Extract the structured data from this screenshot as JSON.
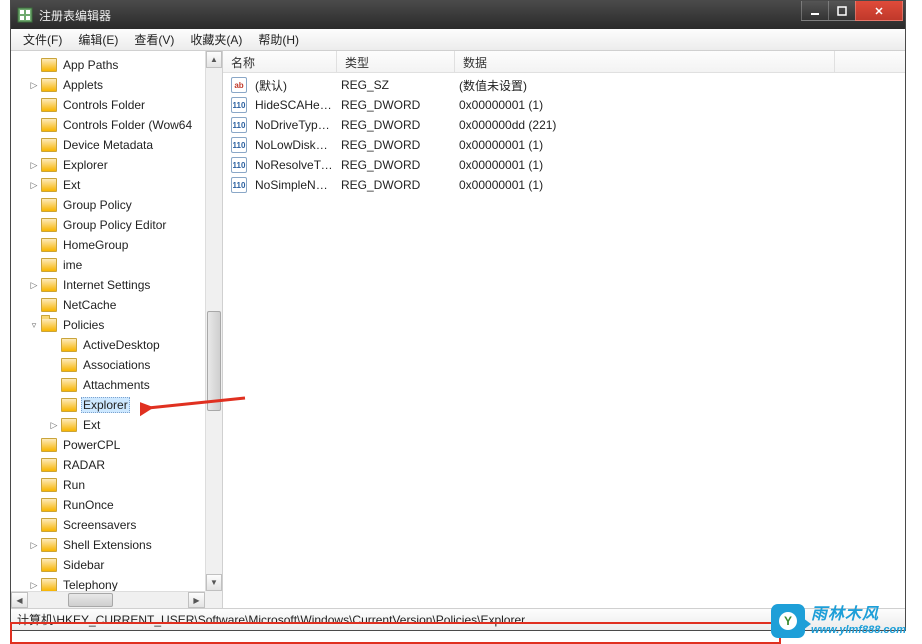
{
  "window": {
    "title": "注册表编辑器"
  },
  "menu": {
    "file": "文件(F)",
    "edit": "编辑(E)",
    "view": "查看(V)",
    "favorites": "收藏夹(A)",
    "help": "帮助(H)"
  },
  "tree": {
    "items": [
      {
        "label": "App Paths",
        "indent": 1,
        "expander": ""
      },
      {
        "label": "Applets",
        "indent": 1,
        "expander": "▷"
      },
      {
        "label": "Controls Folder",
        "indent": 1,
        "expander": ""
      },
      {
        "label": "Controls Folder (Wow64",
        "indent": 1,
        "expander": ""
      },
      {
        "label": "Device Metadata",
        "indent": 1,
        "expander": ""
      },
      {
        "label": "Explorer",
        "indent": 1,
        "expander": "▷"
      },
      {
        "label": "Ext",
        "indent": 1,
        "expander": "▷"
      },
      {
        "label": "Group Policy",
        "indent": 1,
        "expander": ""
      },
      {
        "label": "Group Policy Editor",
        "indent": 1,
        "expander": ""
      },
      {
        "label": "HomeGroup",
        "indent": 1,
        "expander": ""
      },
      {
        "label": "ime",
        "indent": 1,
        "expander": ""
      },
      {
        "label": "Internet Settings",
        "indent": 1,
        "expander": "▷"
      },
      {
        "label": "NetCache",
        "indent": 1,
        "expander": ""
      },
      {
        "label": "Policies",
        "indent": 1,
        "expander": "▿",
        "open": true
      },
      {
        "label": "ActiveDesktop",
        "indent": 2,
        "expander": ""
      },
      {
        "label": "Associations",
        "indent": 2,
        "expander": ""
      },
      {
        "label": "Attachments",
        "indent": 2,
        "expander": ""
      },
      {
        "label": "Explorer",
        "indent": 2,
        "expander": "",
        "selected": true
      },
      {
        "label": "Ext",
        "indent": 2,
        "expander": "▷"
      },
      {
        "label": "PowerCPL",
        "indent": 1,
        "expander": ""
      },
      {
        "label": "RADAR",
        "indent": 1,
        "expander": ""
      },
      {
        "label": "Run",
        "indent": 1,
        "expander": ""
      },
      {
        "label": "RunOnce",
        "indent": 1,
        "expander": ""
      },
      {
        "label": "Screensavers",
        "indent": 1,
        "expander": ""
      },
      {
        "label": "Shell Extensions",
        "indent": 1,
        "expander": "▷"
      },
      {
        "label": "Sidebar",
        "indent": 1,
        "expander": ""
      },
      {
        "label": "Telephony",
        "indent": 1,
        "expander": "▷"
      }
    ]
  },
  "columns": {
    "name": "名称",
    "type": "类型",
    "data": "数据",
    "widths": {
      "name": 114,
      "type": 118,
      "data": 380
    }
  },
  "values": [
    {
      "icon": "str",
      "name": "(默认)",
      "type": "REG_SZ",
      "data": "(数值未设置)"
    },
    {
      "icon": "dw",
      "name": "HideSCAHealth",
      "type": "REG_DWORD",
      "data": "0x00000001 (1)"
    },
    {
      "icon": "dw",
      "name": "NoDriveTypeA...",
      "type": "REG_DWORD",
      "data": "0x000000dd (221)"
    },
    {
      "icon": "dw",
      "name": "NoLowDiskSp...",
      "type": "REG_DWORD",
      "data": "0x00000001 (1)"
    },
    {
      "icon": "dw",
      "name": "NoResolveTrack",
      "type": "REG_DWORD",
      "data": "0x00000001 (1)"
    },
    {
      "icon": "dw",
      "name": "NoSimpleNetI...",
      "type": "REG_DWORD",
      "data": "0x00000001 (1)"
    }
  ],
  "statusbar": {
    "path": "计算机\\HKEY_CURRENT_USER\\Software\\Microsoft\\Windows\\CurrentVersion\\Policies\\Explorer"
  },
  "watermark": {
    "brand": "雨林木风",
    "url": "www.ylmf888.com",
    "leaf": "Y"
  }
}
